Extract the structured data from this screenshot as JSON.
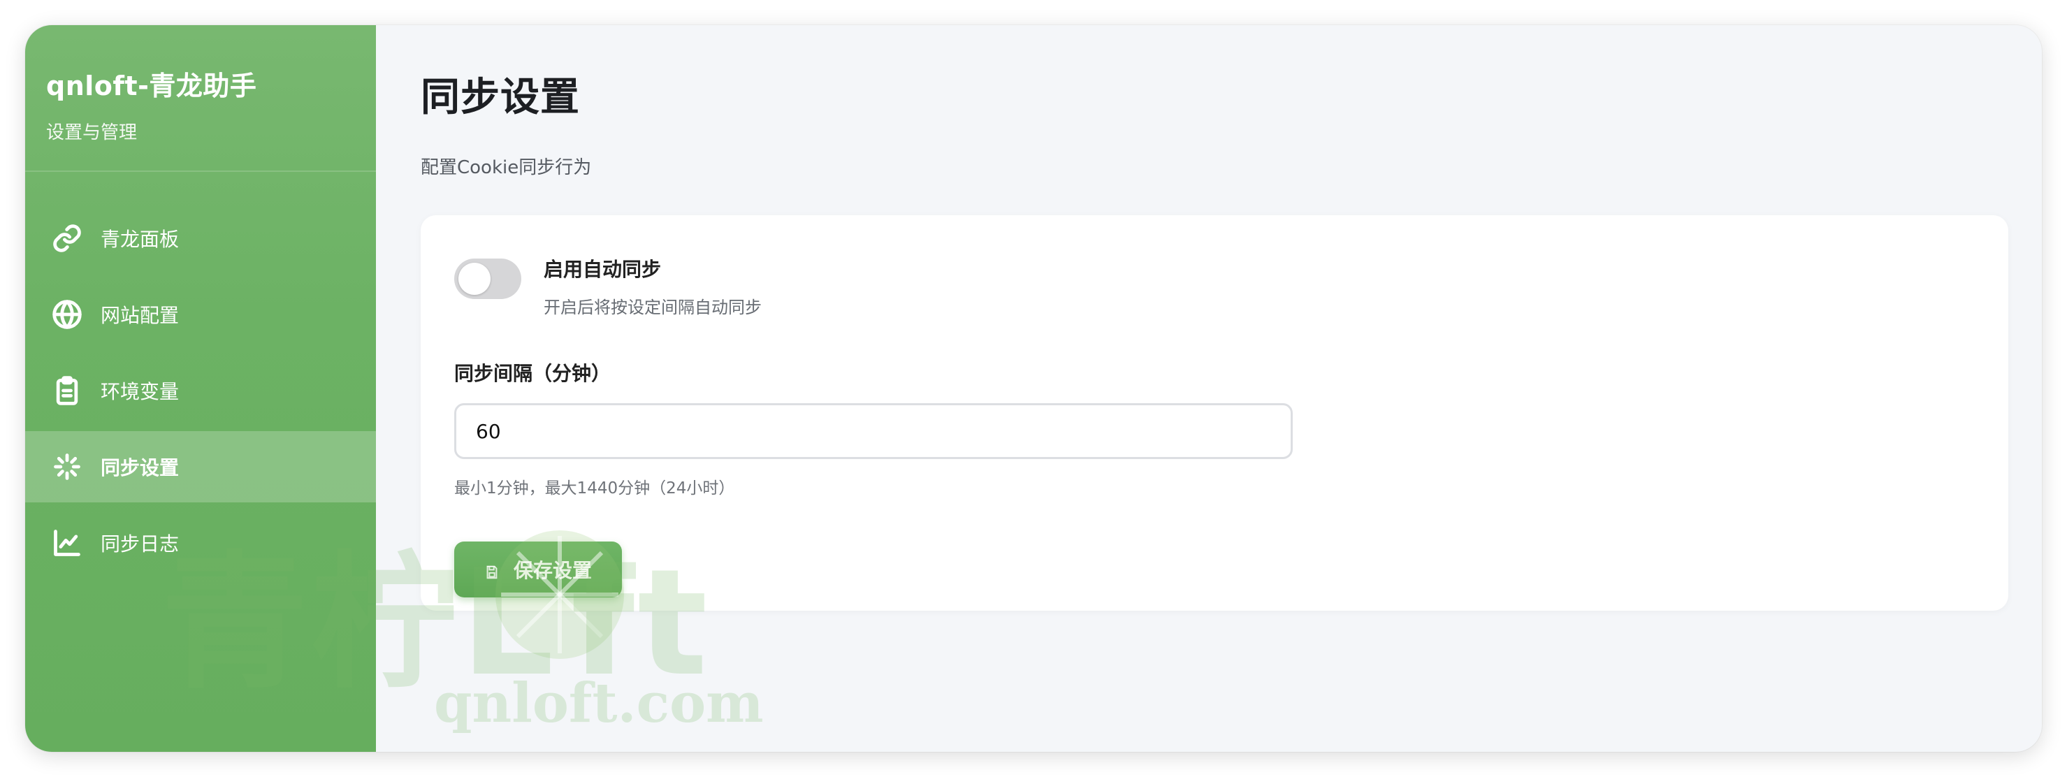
{
  "sidebar": {
    "brand_title": "qnloft-青龙助手",
    "brand_subtitle": "设置与管理",
    "items": [
      {
        "label": "青龙面板",
        "icon": "link-icon",
        "active": false
      },
      {
        "label": "网站配置",
        "icon": "globe-icon",
        "active": false
      },
      {
        "label": "环境变量",
        "icon": "clipboard-icon",
        "active": false
      },
      {
        "label": "同步设置",
        "icon": "sparkle-icon",
        "active": true
      },
      {
        "label": "同步日志",
        "icon": "line-chart-icon",
        "active": false
      }
    ]
  },
  "watermark": {
    "line1": "青柠L",
    "line1_tail": "ft",
    "line2": "qnloft.com"
  },
  "main": {
    "title": "同步设置",
    "description": "配置Cookie同步行为",
    "auto_sync": {
      "label": "启用自动同步",
      "description": "开启后将按设定间隔自动同步",
      "enabled": false
    },
    "interval": {
      "label": "同步间隔（分钟）",
      "value": "60",
      "hint": "最小1分钟，最大1440分钟（24小时）"
    },
    "save_label": "保存设置"
  },
  "colors": {
    "sidebar_green": "#6cb264",
    "accent_green": "#5ea855",
    "background": "#f4f6f9"
  }
}
